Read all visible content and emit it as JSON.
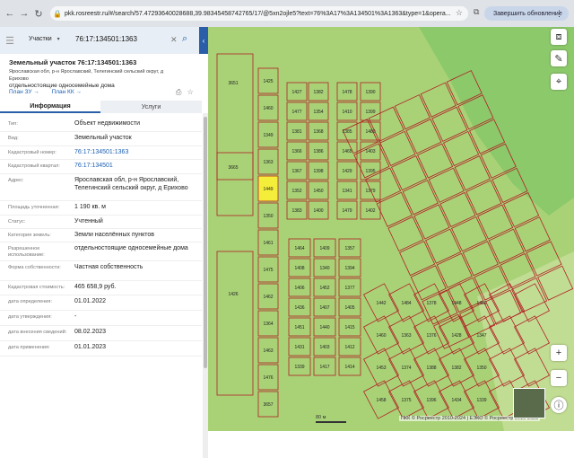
{
  "browser": {
    "url": "pkk.rosreestr.ru/#/search/57.47293640028688,39.98345458742765/17/@5xn2ojle5?text=76%3A17%3A134501%3A1363&type=1&opera...",
    "update_label": "Завершить обновление"
  },
  "search": {
    "type_label": "Участки",
    "value": "76:17:134501:1363"
  },
  "object": {
    "title": "Земельный участок 76:17:134501:1363",
    "address_line": "Ярославская обл, р-н Ярославский, Телегинский сельский округ, д Ерихово",
    "use_line": "отдельностоящие односемейные дома",
    "plan_zu": "План ЗУ →",
    "plan_kk": "План КК →"
  },
  "tabs": {
    "info": "Информация",
    "services": "Услуги"
  },
  "properties": [
    {
      "k": "Тип:",
      "v": "Объект недвижимости"
    },
    {
      "k": "Вид:",
      "v": "Земельный участок"
    },
    {
      "k": "Кадастровый номер:",
      "v": "76:17:134501:1363"
    },
    {
      "k": "Кадастровый квартал:",
      "v": "76:17:134501"
    },
    {
      "k": "Адрес:",
      "v": "Ярославская обл, р-н Ярославский, Телегинский сельский округ, д Ерихово"
    },
    {
      "k": "Площадь уточненная:",
      "v": "1 190 кв. м"
    },
    {
      "k": "Статус:",
      "v": "Учтенный"
    },
    {
      "k": "Категория земель:",
      "v": "Земли населённых пунктов"
    },
    {
      "k": "Разрешенное использование:",
      "v": "отдельностоящие односемейные дома"
    },
    {
      "k": "Форма собственности:",
      "v": "Частная собственность"
    },
    {
      "k": "Кадастровая стоимость:",
      "v": "465 658,9 руб."
    },
    {
      "k": "дата определения:",
      "v": "01.01.2022"
    },
    {
      "k": "дата утверждения:",
      "v": "-"
    },
    {
      "k": "дата внесения сведений:",
      "v": "08.02.2023"
    },
    {
      "k": "дата применения:",
      "v": "01.01.2023"
    }
  ],
  "map": {
    "parcel_labels": [
      "3651",
      "1425",
      "1460",
      "1349",
      "1363",
      "1449",
      "1350",
      "1461",
      "1475",
      "1462",
      "1364",
      "1463",
      "1476",
      "3657",
      "3665",
      "1426",
      "1427",
      "1477",
      "1381",
      "1366",
      "1367",
      "1352",
      "1383",
      "1382",
      "1354",
      "1368",
      "1386",
      "1398",
      "1450",
      "1400",
      "1478",
      "1410",
      "1385",
      "1465",
      "1429",
      "1341",
      "1479",
      "1390",
      "1399",
      "1480",
      "1403",
      "1395",
      "1379",
      "1402",
      "1464",
      "1408",
      "1406",
      "1436",
      "1451",
      "1431",
      "1339",
      "1409",
      "1340",
      "1452",
      "1407",
      "1440",
      "1403",
      "1417",
      "1357",
      "1394",
      "1377",
      "1405",
      "1415",
      "1412",
      "1414",
      "1442",
      "1460",
      "1453",
      "1458",
      "1484",
      "1363",
      "1374",
      "1375",
      "1378",
      "1376",
      "1388",
      "1396",
      "1448",
      "1428",
      "1382",
      "1434",
      "1469",
      "1347",
      "1350",
      "1339"
    ],
    "scale_label": "80 м",
    "copyright": "ПКК © Росреестр 2010-2024 | ЕЭКО © Росреестр 2019-2023"
  },
  "colors": {
    "map_bg": "#a9d277",
    "parcel_border": "#b21e24",
    "selected": "#f4ee3a",
    "accent": "#2b5ea8"
  }
}
